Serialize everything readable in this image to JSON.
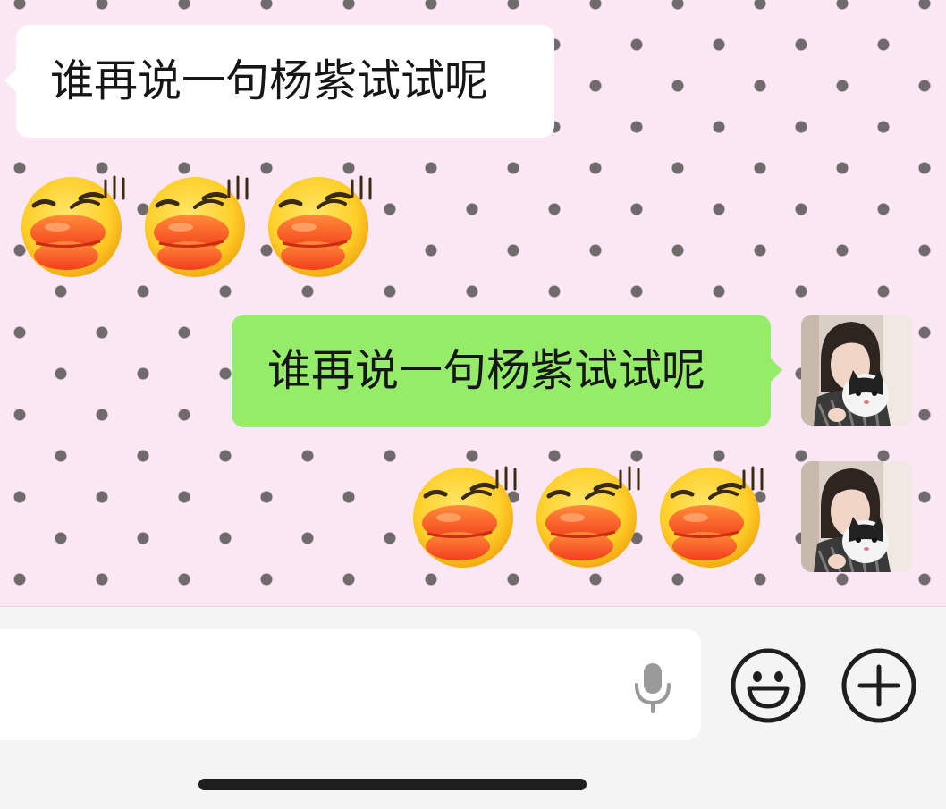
{
  "chat": {
    "incoming": {
      "text": "谁再说一句杨紫试试呢",
      "emojis": [
        "duck-face-emoji",
        "duck-face-emoji",
        "duck-face-emoji"
      ]
    },
    "outgoing": {
      "text": "谁再说一句杨紫试试呢",
      "emojis": [
        "duck-face-emoji",
        "duck-face-emoji",
        "duck-face-emoji"
      ]
    }
  },
  "input_bar": {
    "placeholder": "",
    "icons": [
      "microphone-icon",
      "emoji-smile-icon",
      "plus-circle-icon"
    ]
  },
  "colors": {
    "background": "#fbe6f4",
    "dot": "#6f6b6d",
    "incoming_bubble": "#ffffff",
    "outgoing_bubble": "#95ec69",
    "input_area": "#f4f4f4",
    "icon": "#1e1e1e"
  }
}
